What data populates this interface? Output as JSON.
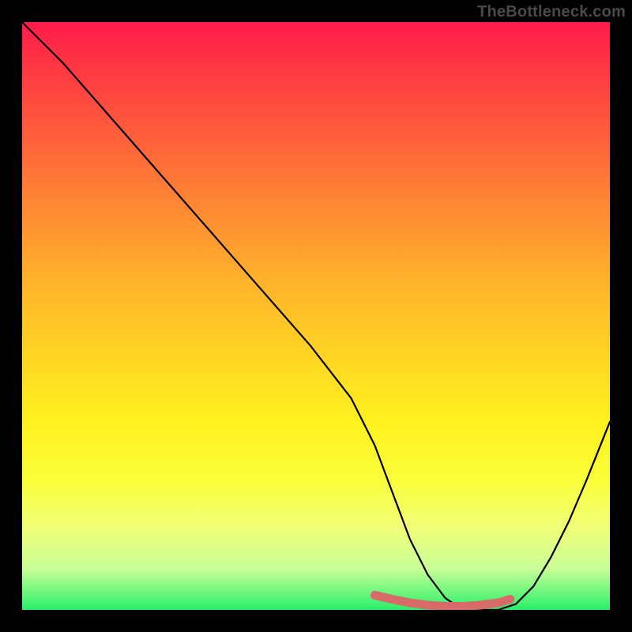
{
  "watermark": "TheBottleneck.com",
  "chart_data": {
    "type": "line",
    "title": "",
    "xlabel": "",
    "ylabel": "",
    "xlim": [
      0,
      100
    ],
    "ylim": [
      0,
      100
    ],
    "series": [
      {
        "name": "curve",
        "x": [
          0,
          7,
          14,
          21,
          28,
          35,
          42,
          49,
          56,
          60,
          63,
          66,
          69,
          72,
          75,
          78,
          81,
          84,
          87,
          90,
          93,
          96,
          100
        ],
        "values": [
          100,
          93,
          85,
          77,
          69,
          61,
          53,
          45,
          36,
          28,
          20,
          12,
          6,
          2,
          0,
          0,
          0,
          1,
          4,
          9,
          15,
          22,
          32
        ]
      }
    ],
    "highlight_segment": {
      "name": "bottleneck-band",
      "x": [
        60,
        63,
        66,
        69,
        72,
        75,
        78,
        81,
        83
      ],
      "values": [
        2.5,
        1.8,
        1.2,
        0.8,
        0.6,
        0.6,
        0.8,
        1.2,
        1.8
      ]
    },
    "gradient_stops": [
      {
        "pos": 0,
        "color": "#ff1a4b"
      },
      {
        "pos": 7,
        "color": "#ff3543"
      },
      {
        "pos": 18,
        "color": "#ff5a3c"
      },
      {
        "pos": 32,
        "color": "#ff8a33"
      },
      {
        "pos": 44,
        "color": "#ffb22b"
      },
      {
        "pos": 56,
        "color": "#ffd324"
      },
      {
        "pos": 68,
        "color": "#fff11e"
      },
      {
        "pos": 78,
        "color": "#fbff3a"
      },
      {
        "pos": 86,
        "color": "#f1ff77"
      },
      {
        "pos": 93,
        "color": "#c8ff97"
      },
      {
        "pos": 100,
        "color": "#29f06a"
      }
    ],
    "highlight_color": "#d96a6a",
    "curve_color": "#000000"
  }
}
